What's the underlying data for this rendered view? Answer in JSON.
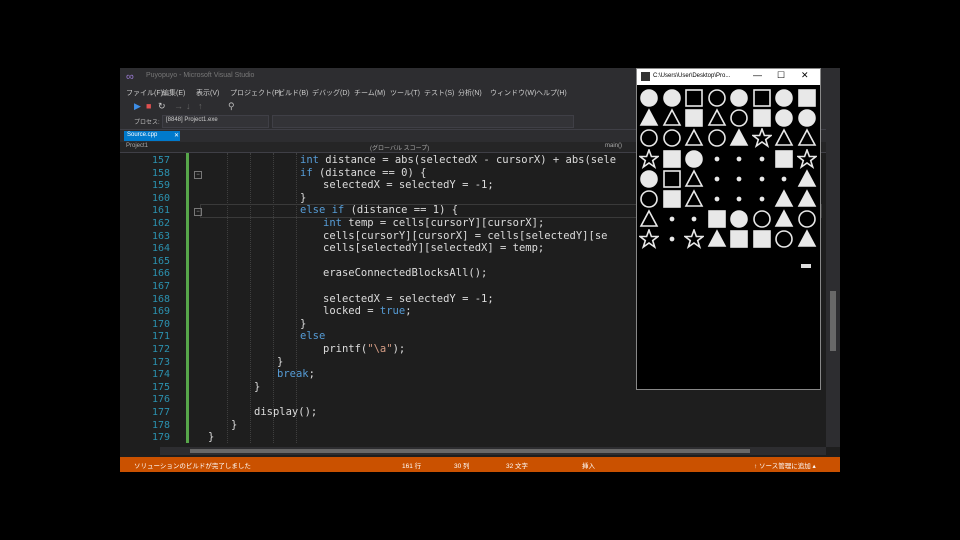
{
  "ide": {
    "title_text": "Puyopuyo - Microsoft Visual Studio",
    "menu": [
      "ファイル(F)",
      "編集(E)",
      "表示(V)",
      "プロジェクト(P)",
      "ビルド(B)",
      "デバッグ(D)",
      "チーム(M)",
      "ツール(T)",
      "テスト(S)",
      "分析(N)",
      "ウィンドウ(W)",
      "ヘルプ(H)"
    ],
    "project_label": "プロセス:",
    "project_value": "[8848] Project1.exe",
    "tab_label": "Source.cpp",
    "tab_close": "✕",
    "nav_left": "Project1",
    "nav_mid": "(グローバル スコープ)",
    "nav_right": "main()",
    "status_left": "ソリューションのビルドが完了しました",
    "status_ln": "161 行",
    "status_col": "30 列",
    "status_ch": "32 文字",
    "status_ins": "挿入",
    "status_right": "↑ ソース管理に追加 ▴"
  },
  "code_lines": [
    {
      "num": "157",
      "indent": 6,
      "parts": [
        {
          "t": "int ",
          "k": "kw"
        },
        {
          "t": "distance = abs(selectedX - cursorX) + abs(sele"
        }
      ]
    },
    {
      "num": "158",
      "indent": 6,
      "parts": [
        {
          "t": "if ",
          "k": "kw"
        },
        {
          "t": "(distance == 0) {"
        }
      ]
    },
    {
      "num": "159",
      "indent": 7,
      "parts": [
        {
          "t": "selectedX = selectedY = -1;"
        }
      ]
    },
    {
      "num": "160",
      "indent": 6,
      "parts": [
        {
          "t": "}"
        }
      ]
    },
    {
      "num": "161",
      "indent": 6,
      "parts": [
        {
          "t": "else if ",
          "k": "kw"
        },
        {
          "t": "(distance == 1) {"
        }
      ]
    },
    {
      "num": "162",
      "indent": 7,
      "parts": [
        {
          "t": "int ",
          "k": "kw"
        },
        {
          "t": "temp = cells[cursorY][cursorX];"
        }
      ]
    },
    {
      "num": "163",
      "indent": 7,
      "parts": [
        {
          "t": "cells[cursorY][cursorX] = cells[selectedY][se"
        }
      ]
    },
    {
      "num": "164",
      "indent": 7,
      "parts": [
        {
          "t": "cells[selectedY][selectedX] = temp;"
        }
      ]
    },
    {
      "num": "165",
      "indent": 7,
      "parts": [
        {
          "t": ""
        }
      ]
    },
    {
      "num": "166",
      "indent": 7,
      "parts": [
        {
          "t": "eraseConnectedBlocksAll();"
        }
      ]
    },
    {
      "num": "167",
      "indent": 7,
      "parts": [
        {
          "t": ""
        }
      ]
    },
    {
      "num": "168",
      "indent": 7,
      "parts": [
        {
          "t": "selectedX = selectedY = -1;"
        }
      ]
    },
    {
      "num": "169",
      "indent": 7,
      "parts": [
        {
          "t": "locked = "
        },
        {
          "t": "true",
          "k": "kw"
        },
        {
          "t": ";"
        }
      ]
    },
    {
      "num": "170",
      "indent": 6,
      "parts": [
        {
          "t": "}"
        }
      ]
    },
    {
      "num": "171",
      "indent": 6,
      "parts": [
        {
          "t": "else",
          "k": "kw"
        }
      ]
    },
    {
      "num": "172",
      "indent": 7,
      "parts": [
        {
          "t": "printf("
        },
        {
          "t": "\"\\a\"",
          "k": "str"
        },
        {
          "t": ");"
        }
      ]
    },
    {
      "num": "173",
      "indent": 5,
      "parts": [
        {
          "t": "}"
        }
      ]
    },
    {
      "num": "174",
      "indent": 5,
      "parts": [
        {
          "t": "break",
          "k": "kw"
        },
        {
          "t": ";"
        }
      ]
    },
    {
      "num": "175",
      "indent": 4,
      "parts": [
        {
          "t": "}"
        }
      ]
    },
    {
      "num": "176",
      "indent": 4,
      "parts": [
        {
          "t": ""
        }
      ]
    },
    {
      "num": "177",
      "indent": 4,
      "parts": [
        {
          "t": "display();"
        }
      ]
    },
    {
      "num": "178",
      "indent": 3,
      "parts": [
        {
          "t": "}"
        }
      ]
    },
    {
      "num": "179",
      "indent": 2,
      "parts": [
        {
          "t": "}"
        }
      ]
    }
  ],
  "console": {
    "title": "C:\\Users\\User\\Desktop\\Pro...",
    "min": "—",
    "max": "☐",
    "close": "✕",
    "grid": [
      [
        "circle",
        "circle",
        "square-o",
        "circle-o",
        "circle",
        "square-o",
        "circle",
        "square"
      ],
      [
        "triangle",
        "triangle-o",
        "square",
        "triangle-o",
        "circle-o",
        "square",
        "circle",
        "circle"
      ],
      [
        "circle-o",
        "circle-o",
        "triangle-o",
        "circle-o",
        "triangle",
        "star-o",
        "triangle-o",
        "triangle-o"
      ],
      [
        "star-o",
        "square",
        "circle",
        "dot",
        "dot",
        "dot",
        "square",
        "star-o"
      ],
      [
        "circle",
        "square-o",
        "triangle-o",
        "dot",
        "dot",
        "dot",
        "dot",
        "triangle"
      ],
      [
        "circle-o",
        "square",
        "triangle-o",
        "dot",
        "dot",
        "dot",
        "triangle",
        "triangle"
      ],
      [
        "triangle-o",
        "dot",
        "dot",
        "square",
        "circle",
        "circle-o",
        "triangle",
        "circle-o"
      ],
      [
        "star-o",
        "dot",
        "star-o",
        "triangle",
        "square",
        "square",
        "circle-o",
        "triangle"
      ]
    ]
  }
}
